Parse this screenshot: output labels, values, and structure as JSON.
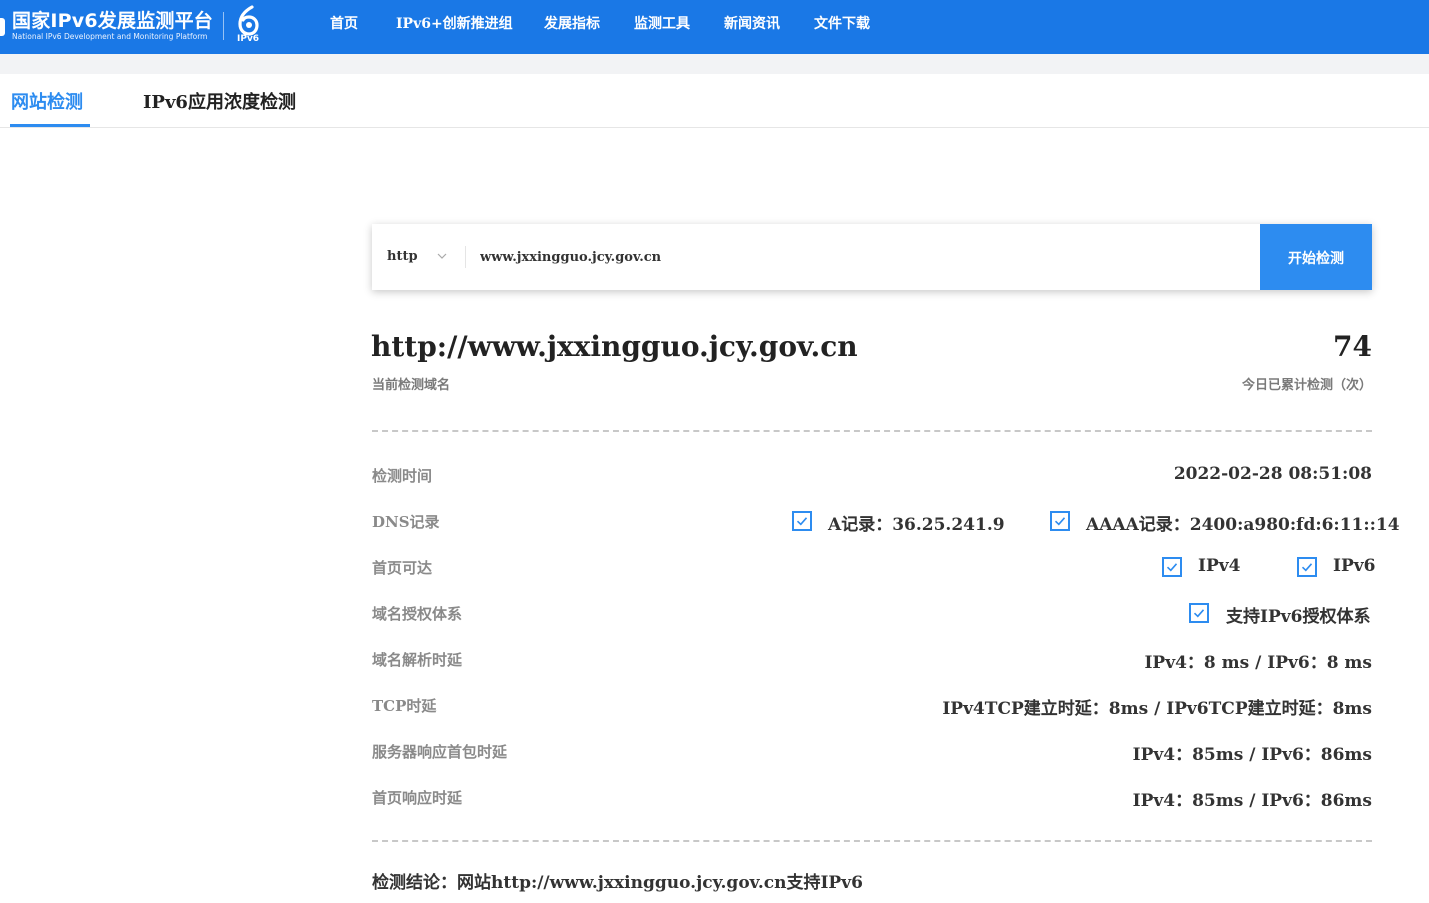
{
  "header": {
    "logo_zh": "国家IPv6发展监测平台",
    "logo_en": "National IPv6 Development and Monitoring Platform",
    "logo_mark_text": "IPv6",
    "nav": [
      "首页",
      "IPv6+创新推进组",
      "发展指标",
      "监测工具",
      "新闻资讯",
      "文件下载"
    ]
  },
  "tabs": [
    "网站检测",
    "IPv6应用浓度检测"
  ],
  "search": {
    "protocol": "http",
    "url_value": "www.jxxingguo.jcy.gov.cn",
    "button_label": "开始检测"
  },
  "summary": {
    "domain": "http://www.jxxingguo.jcy.gov.cn",
    "domain_caption": "当前检测域名",
    "count": "74",
    "count_caption": "今日已累计检测（次）"
  },
  "rows": {
    "time_label": "检测时间",
    "time_value": "2022-02-28 08:51:08",
    "dns_label": "DNS记录",
    "dns_a": "A记录：36.25.241.9",
    "dns_aaaa": "AAAA记录：2400:a980:fd:6:11::14",
    "home_label": "首页可达",
    "home_ipv4": "IPv4",
    "home_ipv6": "IPv6",
    "auth_label": "域名授权体系",
    "auth_value": "支持IPv6授权体系",
    "resolve_label": "域名解析时延",
    "resolve_value": "IPv4：8 ms / IPv6：8 ms",
    "tcp_label": "TCP时延",
    "tcp_value": "IPv4TCP建立时延：8ms / IPv6TCP建立时延：8ms",
    "first_packet_label": "服务器响应首包时延",
    "first_packet_value": "IPv4：85ms / IPv6：86ms",
    "home_resp_label": "首页响应时延",
    "home_resp_value": "IPv4：85ms / IPv6：86ms"
  },
  "conclusion": "检测结论：网站http://www.jxxingguo.jcy.gov.cn支持IPv6",
  "colors": {
    "brand_blue": "#1a78e6",
    "accent_blue": "#2d8cf0"
  }
}
